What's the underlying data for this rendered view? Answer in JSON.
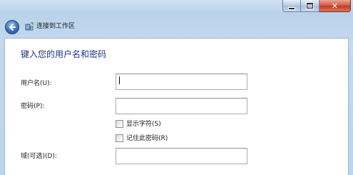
{
  "window": {
    "nav_title": "连接到工作区"
  },
  "form": {
    "heading": "键入您的用户名和密码",
    "username_label": "用户名(U):",
    "username_value": "",
    "password_label": "密码(P):",
    "password_value": "",
    "show_chars_label": "显示字符(S)",
    "remember_password_label": "记住此密码(R)",
    "domain_label": "域(可选)(D):",
    "domain_value": ""
  },
  "icons": {
    "back": "back-arrow-icon",
    "nav": "workplace-connection-icon",
    "minimize": "minimize-icon",
    "maximize": "maximize-icon",
    "close": "close-icon"
  },
  "colors": {
    "heading": "#1e3287",
    "frame": "#bcd4ec",
    "close_button": "#c03a1e"
  }
}
